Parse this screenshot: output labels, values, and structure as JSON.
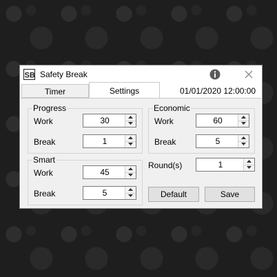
{
  "window": {
    "title": "Safety Break",
    "logo_text": "SB",
    "datetime": "01/01/2020  12:00:00"
  },
  "tabs": [
    {
      "label": "Timer",
      "active": false
    },
    {
      "label": "Settings",
      "active": true
    }
  ],
  "progress": {
    "title": "Progress",
    "work_label": "Work",
    "work_value": "30",
    "break_label": "Break",
    "break_value": "1"
  },
  "smart": {
    "title": "Smart",
    "work_label": "Work",
    "work_value": "45",
    "break_label": "Break",
    "break_value": "5"
  },
  "economic": {
    "title": "Economic",
    "work_label": "Work",
    "work_value": "60",
    "break_label": "Break",
    "break_value": "5"
  },
  "rounds": {
    "label": "Round(s)",
    "value": "1"
  },
  "buttons": {
    "default_label": "Default",
    "save_label": "Save"
  },
  "icons": {
    "info": "info-icon",
    "close": "close-icon",
    "spin_up": "chevron-up-icon",
    "spin_down": "chevron-down-icon"
  },
  "colors": {
    "info_icon": "#5a5a5a",
    "close_icon": "#8a8a8a",
    "panel_bg": "#f0f0f0"
  }
}
